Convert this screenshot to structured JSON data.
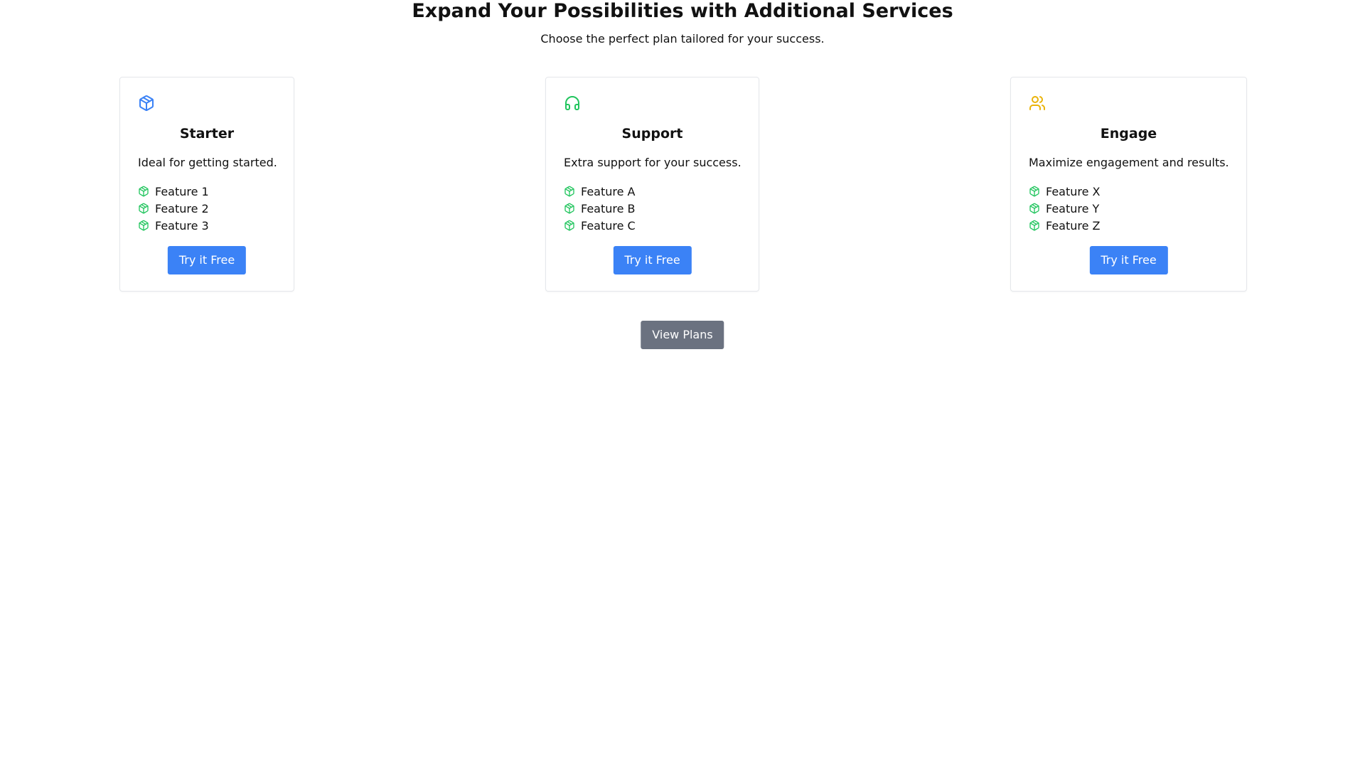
{
  "header": {
    "title": "Expand Your Possibilities with Additional Services",
    "subtitle": "Choose the perfect plan tailored for your success."
  },
  "colors": {
    "primary_button": "#3b82f6",
    "secondary_button": "#6b7280",
    "starter_icon": "#3b82f6",
    "support_icon": "#22c55e",
    "engage_icon": "#eab308",
    "feature_icon": "#22c55e",
    "card_border": "#e5e7eb"
  },
  "cards": [
    {
      "icon": "package-icon",
      "title": "Starter",
      "description": "Ideal for getting started.",
      "features": [
        "Feature 1",
        "Feature 2",
        "Feature 3"
      ],
      "button_label": "Try it Free"
    },
    {
      "icon": "headset-icon",
      "title": "Support",
      "description": "Extra support for your success.",
      "features": [
        "Feature A",
        "Feature B",
        "Feature C"
      ],
      "button_label": "Try it Free"
    },
    {
      "icon": "users-icon",
      "title": "Engage",
      "description": "Maximize engagement and results.",
      "features": [
        "Feature X",
        "Feature Y",
        "Feature Z"
      ],
      "button_label": "Try it Free"
    }
  ],
  "footer": {
    "view_plans_label": "View Plans"
  }
}
